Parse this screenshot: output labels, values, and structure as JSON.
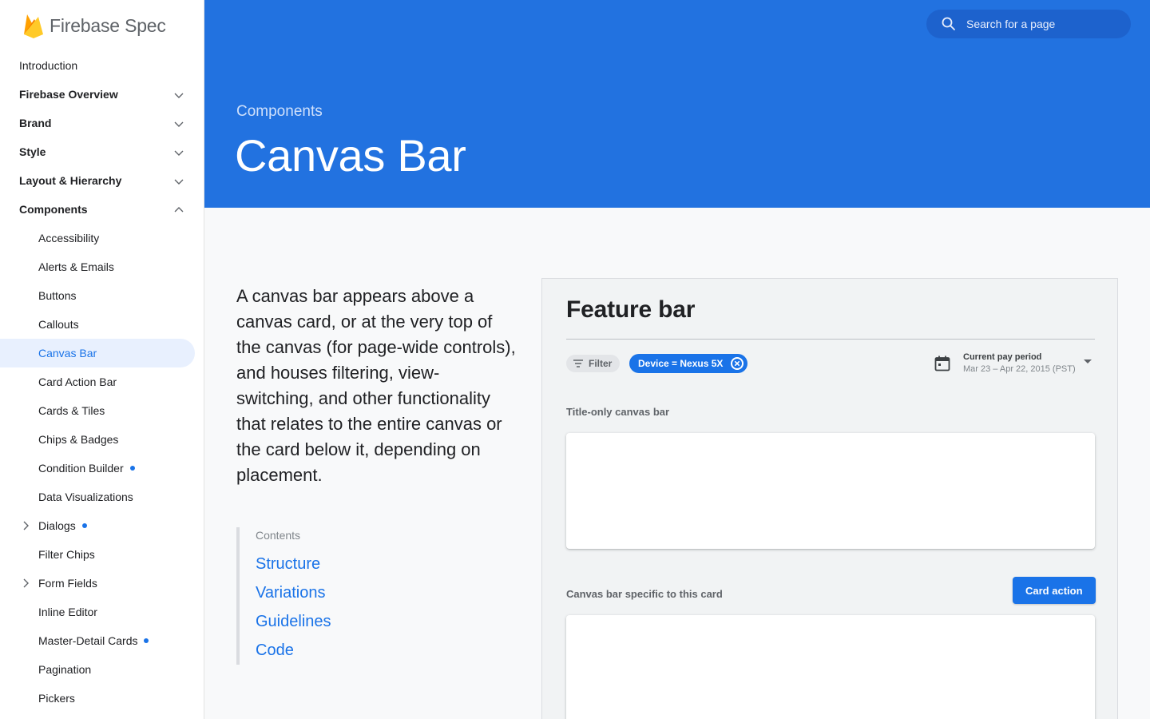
{
  "app": {
    "logo_text": "Firebase Spec"
  },
  "sidebar": {
    "items": [
      {
        "label": "Introduction",
        "level": "top",
        "bold": false,
        "chevron": "none",
        "dot": false,
        "active": false
      },
      {
        "label": "Firebase Overview",
        "level": "top",
        "bold": true,
        "chevron": "down",
        "dot": false,
        "active": false
      },
      {
        "label": "Brand",
        "level": "top",
        "bold": true,
        "chevron": "down",
        "dot": false,
        "active": false
      },
      {
        "label": "Style",
        "level": "top",
        "bold": true,
        "chevron": "down",
        "dot": false,
        "active": false
      },
      {
        "label": "Layout & Hierarchy",
        "level": "top",
        "bold": true,
        "chevron": "down",
        "dot": false,
        "active": false
      },
      {
        "label": "Components",
        "level": "top",
        "bold": true,
        "chevron": "up",
        "dot": false,
        "active": false
      },
      {
        "label": "Accessibility",
        "level": "sub",
        "chevron": "none",
        "dot": false,
        "active": false
      },
      {
        "label": "Alerts & Emails",
        "level": "sub",
        "chevron": "none",
        "dot": false,
        "active": false
      },
      {
        "label": "Buttons",
        "level": "sub",
        "chevron": "none",
        "dot": false,
        "active": false
      },
      {
        "label": "Callouts",
        "level": "sub",
        "chevron": "none",
        "dot": false,
        "active": false
      },
      {
        "label": "Canvas Bar",
        "level": "sub",
        "chevron": "none",
        "dot": false,
        "active": true
      },
      {
        "label": "Card Action Bar",
        "level": "sub",
        "chevron": "none",
        "dot": false,
        "active": false
      },
      {
        "label": "Cards & Tiles",
        "level": "sub",
        "chevron": "none",
        "dot": false,
        "active": false
      },
      {
        "label": "Chips & Badges",
        "level": "sub",
        "chevron": "none",
        "dot": false,
        "active": false
      },
      {
        "label": "Condition Builder",
        "level": "sub",
        "chevron": "none",
        "dot": true,
        "active": false
      },
      {
        "label": "Data Visualizations",
        "level": "sub",
        "chevron": "none",
        "dot": false,
        "active": false
      },
      {
        "label": "Dialogs",
        "level": "sub",
        "chevron": "right",
        "dot": true,
        "active": false
      },
      {
        "label": "Filter Chips",
        "level": "sub",
        "chevron": "none",
        "dot": false,
        "active": false
      },
      {
        "label": "Form Fields",
        "level": "sub",
        "chevron": "right",
        "dot": false,
        "active": false
      },
      {
        "label": "Inline Editor",
        "level": "sub",
        "chevron": "none",
        "dot": false,
        "active": false
      },
      {
        "label": "Master-Detail Cards",
        "level": "sub",
        "chevron": "none",
        "dot": true,
        "active": false
      },
      {
        "label": "Pagination",
        "level": "sub",
        "chevron": "none",
        "dot": false,
        "active": false
      },
      {
        "label": "Pickers",
        "level": "sub",
        "chevron": "none",
        "dot": false,
        "active": false
      }
    ]
  },
  "header": {
    "search_placeholder": "Search for a page",
    "breadcrumb": "Components",
    "title": "Canvas Bar",
    "background": "#2272e0"
  },
  "main": {
    "intro": "A canvas bar appears above a canvas card, or at the very top of the canvas (for page-wide controls), and houses filtering, view-switching, and other functionality that relates to the entire canvas or the card below it, depending on placement.",
    "contents_label": "Contents",
    "toc": [
      "Structure",
      "Variations",
      "Guidelines",
      "Code"
    ]
  },
  "demo": {
    "title": "Feature bar",
    "filter_label": "Filter",
    "chip_label": "Device = Nexus 5X",
    "period_title": "Current pay period",
    "period_range": "Mar 23 – Apr 22, 2015 (PST)",
    "label_title_only": "Title-only canvas bar",
    "label_card_specific": "Canvas bar specific to this card",
    "card_action_label": "Card action",
    "accent": "#1a73e8"
  }
}
